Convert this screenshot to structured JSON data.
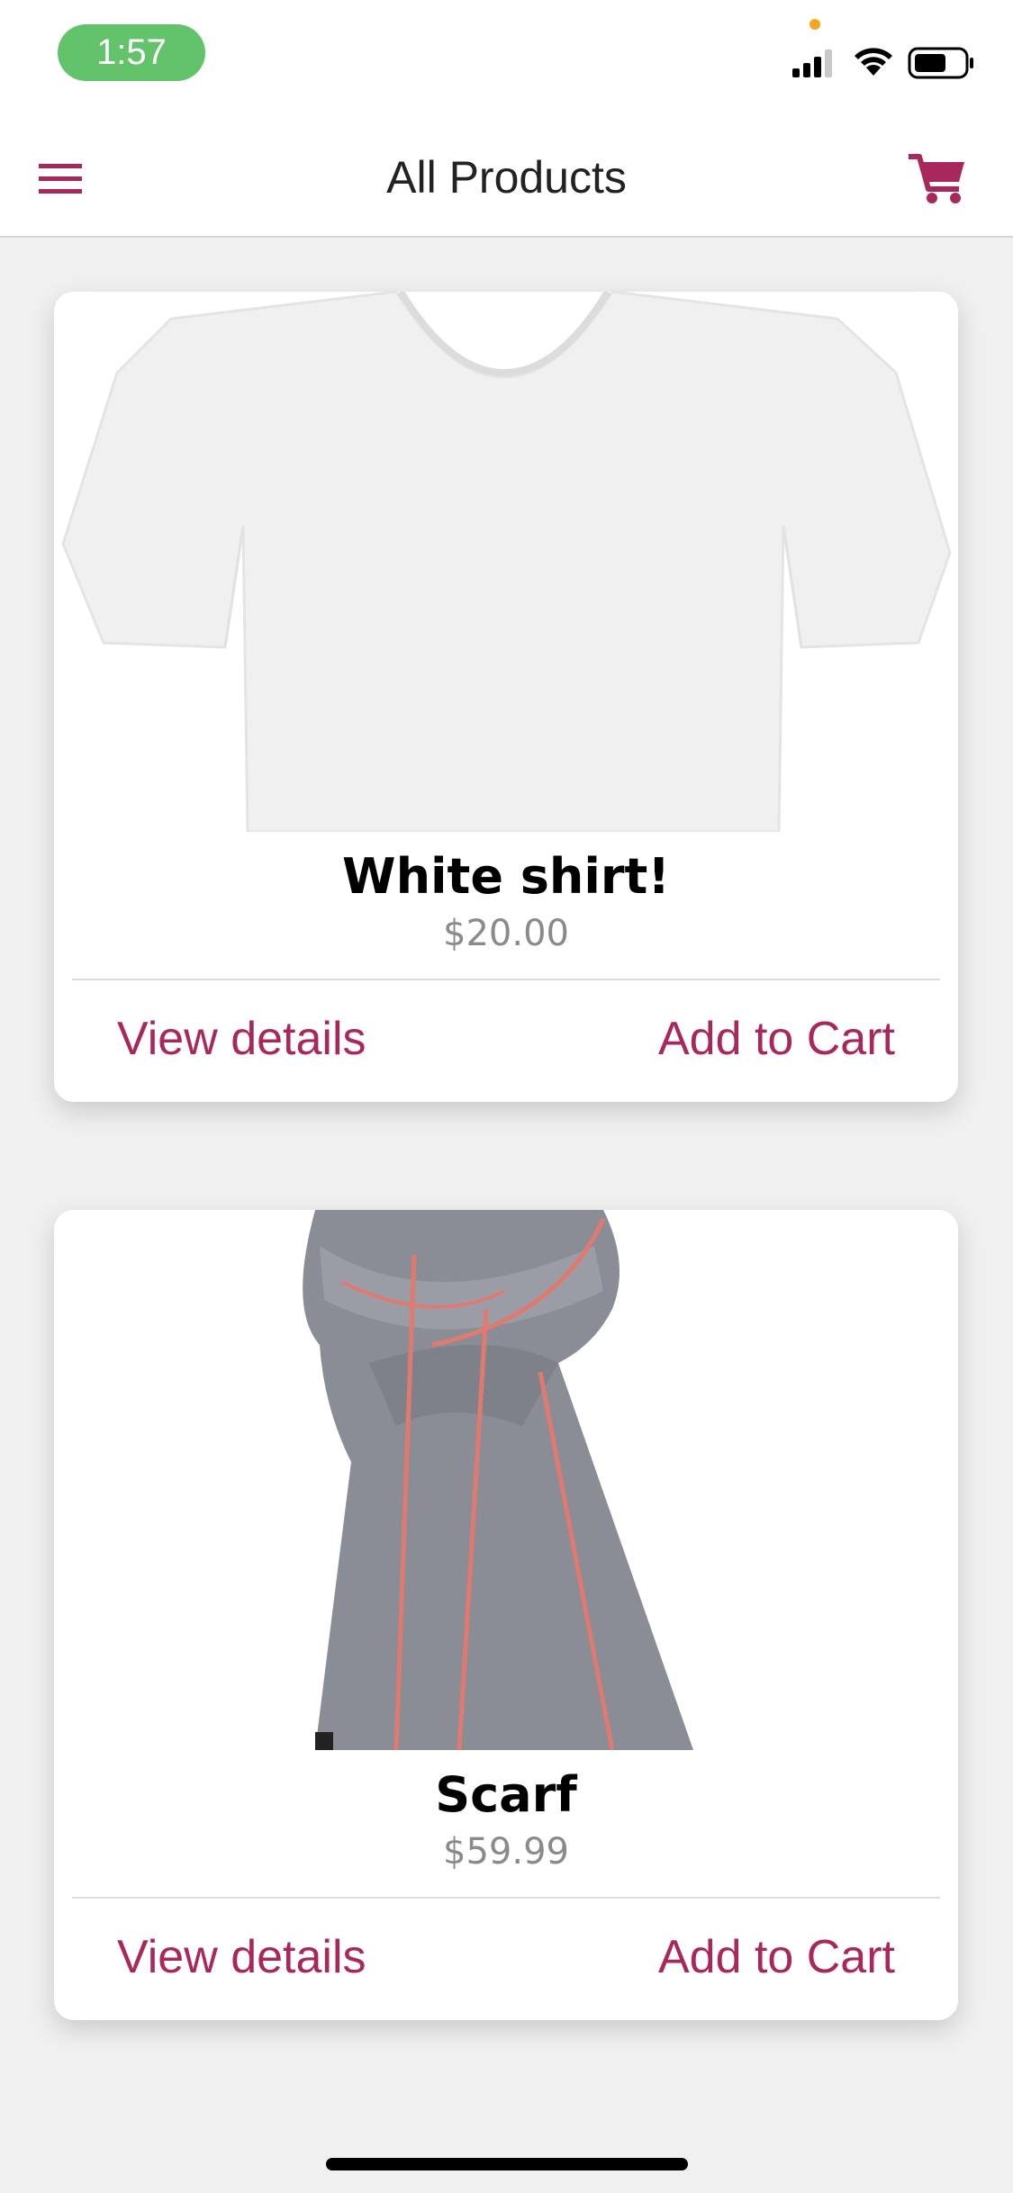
{
  "status_bar": {
    "time": "1:57",
    "icons": [
      "signal-icon",
      "wifi-icon",
      "battery-icon"
    ]
  },
  "nav": {
    "title": "All Products",
    "menu_icon": "hamburger-menu-icon",
    "cart_icon": "cart-icon"
  },
  "colors": {
    "accent": "#a8285e",
    "background": "#f0f0f0",
    "time_pill": "#62c36b"
  },
  "products": [
    {
      "name": "White shirt!",
      "price": "$20.00",
      "image": "white-shirt-image",
      "actions": {
        "details": "View details",
        "add_to_cart": "Add to Cart"
      }
    },
    {
      "name": "Scarf",
      "price": "$59.99",
      "image": "scarf-image",
      "actions": {
        "details": "View details",
        "add_to_cart": "Add to Cart"
      }
    }
  ]
}
